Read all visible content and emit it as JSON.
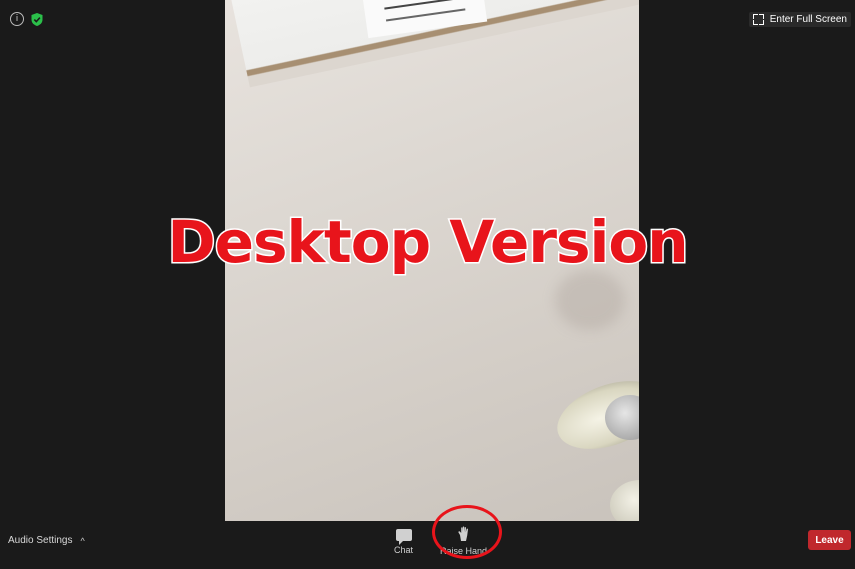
{
  "overlay": {
    "title": "Desktop Version"
  },
  "topbar": {
    "fullscreen_label": "Enter Full Screen"
  },
  "toolbar": {
    "audio_settings_label": "Audio Settings",
    "chat_label": "Chat",
    "raise_hand_label": "Raise Hand",
    "leave_label": "Leave"
  },
  "icons": {
    "info": "info-icon",
    "security": "shield-icon",
    "fullscreen": "fullscreen-icon",
    "chat": "chat-icon",
    "raise_hand": "hand-icon",
    "audio_caret": "caret-up-icon"
  },
  "colors": {
    "overlay_text": "#e8141b",
    "leave_button": "#c0282d",
    "highlight_ring": "#e8141b",
    "background": "#1a1a1a"
  }
}
